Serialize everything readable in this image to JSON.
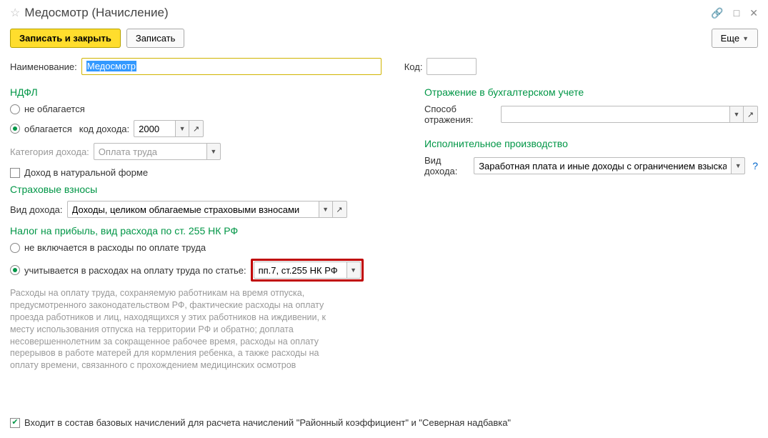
{
  "title": "Медосмотр (Начисление)",
  "toolbar": {
    "save_close": "Записать и закрыть",
    "save": "Записать",
    "more": "Еще"
  },
  "name_row": {
    "label": "Наименование:",
    "value": "Медосмотр",
    "code_label": "Код:"
  },
  "ndfl": {
    "title": "НДФЛ",
    "opt_not_taxed": "не облагается",
    "opt_taxed": "облагается",
    "income_code_label": "код дохода:",
    "income_code_value": "2000",
    "category_label": "Категория дохода:",
    "category_value": "Оплата труда",
    "natural_checkbox": "Доход в натуральной форме"
  },
  "insurance": {
    "title": "Страховые взносы",
    "income_type_label": "Вид дохода:",
    "income_type_value": "Доходы, целиком облагаемые страховыми взносами"
  },
  "profit_tax": {
    "title": "Налог на прибыль, вид расхода по ст. 255 НК РФ",
    "opt_not_included": "не включается в расходы по оплате труда",
    "opt_included": "учитывается в расходах на оплату труда по статье:",
    "article_value": "пп.7, ст.255 НК РФ",
    "description": "Расходы на оплату труда, сохраняемую работникам на время отпуска, предусмотренного законодательством РФ, фактические расходы на оплату проезда работников и лиц, находящихся у этих работников на иждивении, к месту использования отпуска на территории РФ и обратно; доплата несовершеннолетним за сокращенное рабочее время, расходы на оплату перерывов в работе матерей для кормления ребенка, а также расходы на оплату времени, связанного с прохождением медицинских осмотров"
  },
  "accounting": {
    "title": "Отражение в бухгалтерском учете",
    "method_label": "Способ отражения:"
  },
  "executive": {
    "title": "Исполнительное производство",
    "income_type_label": "Вид дохода:",
    "income_type_value": "Заработная плата и иные доходы с ограничением взыскан"
  },
  "footer": {
    "base_check": "Входит в состав базовых начислений для расчета начислений \"Районный коэффициент\" и \"Северная надбавка\""
  }
}
